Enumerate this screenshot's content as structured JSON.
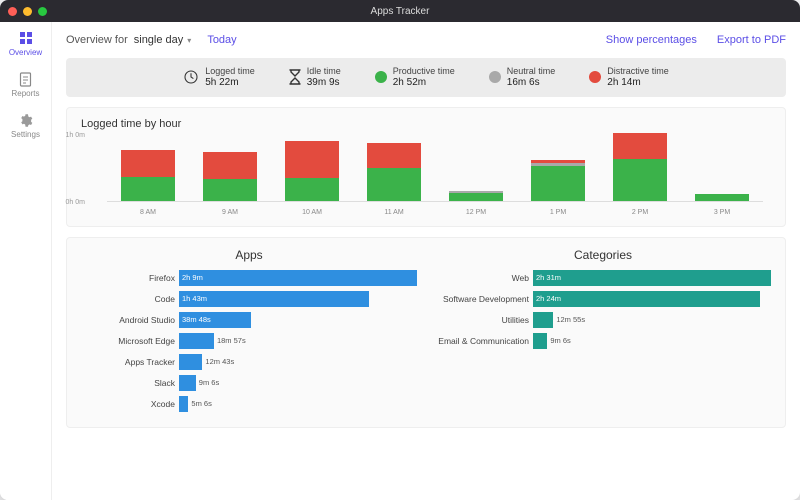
{
  "window": {
    "title": "Apps Tracker"
  },
  "sidebar": {
    "items": [
      {
        "label": "Overview",
        "icon": "grid-icon",
        "active": true
      },
      {
        "label": "Reports",
        "icon": "document-icon",
        "active": false
      },
      {
        "label": "Settings",
        "icon": "gear-icon",
        "active": false
      }
    ]
  },
  "topbar": {
    "overview_for": "Overview for",
    "range": "single day",
    "today": "Today",
    "show_percentages": "Show percentages",
    "export_pdf": "Export to PDF"
  },
  "summary": {
    "logged": {
      "label": "Logged time",
      "value": "5h 22m"
    },
    "idle": {
      "label": "Idle time",
      "value": "39m 9s"
    },
    "productive": {
      "label": "Productive time",
      "value": "2h 52m",
      "color": "#3bb24a"
    },
    "neutral": {
      "label": "Neutral time",
      "value": "16m 6s",
      "color": "#a9a9a9"
    },
    "distractive": {
      "label": "Distractive time",
      "value": "2h 14m",
      "color": "#e34b3e"
    }
  },
  "colors": {
    "productive": "#3bb24a",
    "neutral": "#a9a9a9",
    "distractive": "#e34b3e",
    "apps_bar": "#2f8fe0",
    "cat_bar": "#1f9e8e"
  },
  "chart_data": {
    "hourly": {
      "type": "bar",
      "title": "Logged time by hour",
      "ylabel": "",
      "ylim_minutes": [
        0,
        60
      ],
      "y_ticks": [
        "0h 0m",
        "1h 0m"
      ],
      "categories": [
        "8 AM",
        "9 AM",
        "10 AM",
        "11 AM",
        "12 PM",
        "1 PM",
        "2 PM",
        "3 PM"
      ],
      "series": [
        {
          "name": "Productive",
          "color": "#3bb24a",
          "values_min": [
            22,
            20,
            21,
            30,
            7,
            32,
            38,
            6
          ]
        },
        {
          "name": "Neutral",
          "color": "#a9a9a9",
          "values_min": [
            0,
            0,
            0,
            0,
            2,
            2,
            0,
            0
          ]
        },
        {
          "name": "Distractive",
          "color": "#e34b3e",
          "values_min": [
            24,
            24,
            33,
            23,
            0,
            3,
            24,
            0
          ]
        }
      ]
    },
    "apps": {
      "type": "bar",
      "title": "Apps",
      "orientation": "horizontal",
      "color": "#2f8fe0",
      "items": [
        {
          "label": "Firefox",
          "value_label": "2h 9m",
          "minutes": 129
        },
        {
          "label": "Code",
          "value_label": "1h 43m",
          "minutes": 103
        },
        {
          "label": "Android Studio",
          "value_label": "38m 48s",
          "minutes": 38.8
        },
        {
          "label": "Microsoft Edge",
          "value_label": "18m 57s",
          "minutes": 18.95
        },
        {
          "label": "Apps Tracker",
          "value_label": "12m 43s",
          "minutes": 12.7
        },
        {
          "label": "Slack",
          "value_label": "9m 6s",
          "minutes": 9.1
        },
        {
          "label": "Xcode",
          "value_label": "5m 6s",
          "minutes": 5.1
        }
      ]
    },
    "categories": {
      "type": "bar",
      "title": "Categories",
      "orientation": "horizontal",
      "color": "#1f9e8e",
      "items": [
        {
          "label": "Web",
          "value_label": "2h 31m",
          "minutes": 151
        },
        {
          "label": "Software Development",
          "value_label": "2h 24m",
          "minutes": 144
        },
        {
          "label": "Utilities",
          "value_label": "12m 55s",
          "minutes": 12.9
        },
        {
          "label": "Email & Communication",
          "value_label": "9m 6s",
          "minutes": 9.1
        }
      ]
    }
  }
}
